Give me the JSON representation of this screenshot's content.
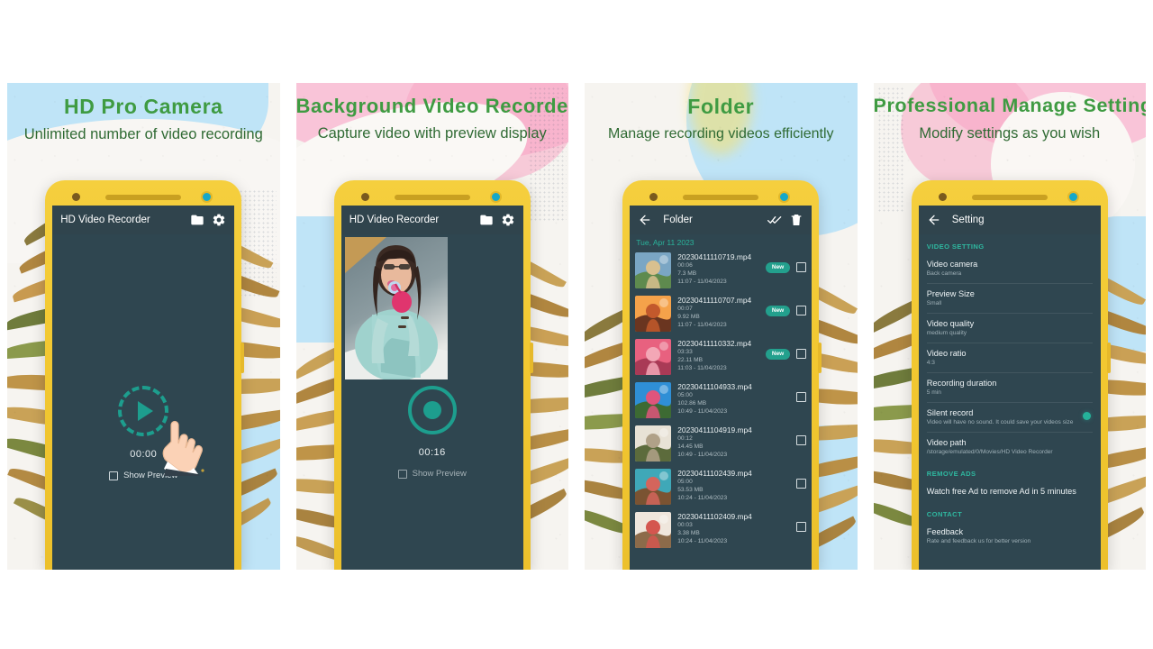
{
  "panels": [
    {
      "heading": "HD Pro Camera",
      "subheading": "Unlimited number of video recording",
      "app": {
        "title": "HD Video Recorder",
        "icons": [
          "folder-icon",
          "gear-icon"
        ],
        "timer": "00:00",
        "preview_label": "Show Preview",
        "preview_checked": false,
        "record_state": "idle"
      }
    },
    {
      "heading": "Background Video Recorder",
      "subheading": "Capture video with preview display",
      "app": {
        "title": "HD Video Recorder",
        "icons": [
          "folder-icon",
          "gear-icon"
        ],
        "timer": "00:16",
        "preview_label": "Show Preview",
        "preview_checked": false,
        "record_state": "recording"
      }
    },
    {
      "heading": "Folder",
      "subheading": "Manage recording videos efficiently",
      "app": {
        "title": "Folder",
        "icons": [
          "back-arrow-icon",
          "select-all-icon",
          "delete-icon"
        ],
        "date_label": "Tue, Apr 11 2023",
        "videos": [
          {
            "name": "20230411110719.mp4",
            "duration": "00:06",
            "size": "7.3 MB",
            "timestamp": "11:07 - 11/04/2023",
            "badge": "New"
          },
          {
            "name": "20230411110707.mp4",
            "duration": "00:07",
            "size": "9.92 MB",
            "timestamp": "11:07 - 11/04/2023",
            "badge": "New"
          },
          {
            "name": "20230411110332.mp4",
            "duration": "03:33",
            "size": "22.11 MB",
            "timestamp": "11:03 - 11/04/2023",
            "badge": "New"
          },
          {
            "name": "20230411104933.mp4",
            "duration": "05:00",
            "size": "102.86 MB",
            "timestamp": "10:49 - 11/04/2023",
            "badge": ""
          },
          {
            "name": "20230411104919.mp4",
            "duration": "00:12",
            "size": "14.45 MB",
            "timestamp": "10:49 - 11/04/2023",
            "badge": ""
          },
          {
            "name": "20230411102439.mp4",
            "duration": "05:00",
            "size": "53.53 MB",
            "timestamp": "10:24 - 11/04/2023",
            "badge": ""
          },
          {
            "name": "20230411102409.mp4",
            "duration": "00:03",
            "size": "3.38 MB",
            "timestamp": "10:24 - 11/04/2023",
            "badge": ""
          }
        ]
      }
    },
    {
      "heading": "Professional Manage Setting",
      "subheading": "Modify settings as you wish",
      "app": {
        "title": "Setting",
        "icons": [
          "back-arrow-icon"
        ],
        "groups": [
          {
            "label": "VIDEO SETTING",
            "items": [
              {
                "title": "Video camera",
                "sub": "Back camera",
                "toggle": false
              },
              {
                "title": "Preview Size",
                "sub": "Small",
                "toggle": false
              },
              {
                "title": "Video quality",
                "sub": "medium quality",
                "toggle": false
              },
              {
                "title": "Video ratio",
                "sub": "4:3",
                "toggle": false
              },
              {
                "title": "Recording duration",
                "sub": "5 min",
                "toggle": false
              },
              {
                "title": "Silent record",
                "sub": "Video will have no sound. It could save your videos size",
                "toggle": true
              },
              {
                "title": "Video path",
                "sub": "/storage/emulated/0/Movies/HD Video Recorder",
                "toggle": false
              }
            ]
          },
          {
            "label": "REMOVE ADS",
            "items": [
              {
                "title": "Watch free Ad to remove Ad in 5 minutes",
                "sub": "",
                "toggle": false
              }
            ]
          },
          {
            "label": "CONTACT",
            "items": [
              {
                "title": "Feedback",
                "sub": "Rate and feedback us for better version",
                "toggle": false
              }
            ]
          }
        ]
      }
    }
  ],
  "colors": {
    "heading_green": "#3f9b42",
    "sub_green": "#2f6a33",
    "phone_yellow": "#f2c831",
    "screen_dark": "#2f4650",
    "accent_teal": "#1d9e8e",
    "group_teal": "#2fb8a0",
    "badge_teal": "#23a08d",
    "sensor_blue": "#16a8c8"
  }
}
